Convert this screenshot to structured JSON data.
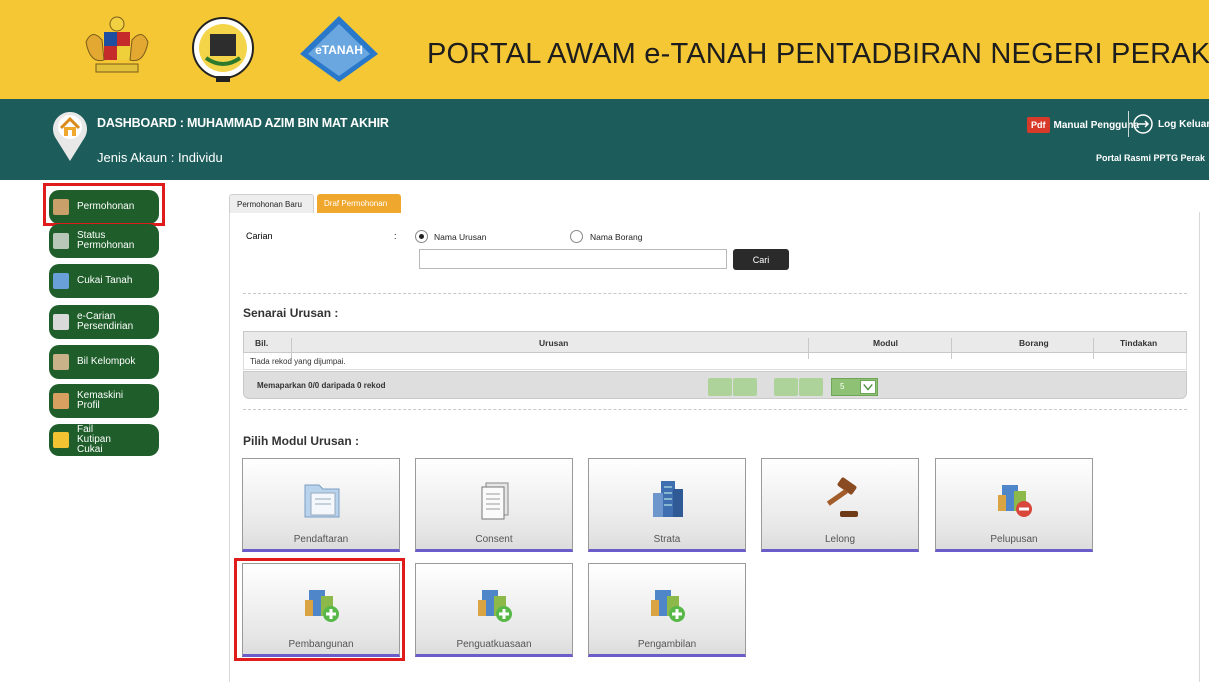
{
  "banner": {
    "title": "PORTAL AWAM e-TANAH PENTADBIRAN NEGERI PERAK",
    "logo3_text": "eTANAH"
  },
  "header": {
    "dashboard_title": "DASHBOARD : MUHAMMAD AZIM BIN MAT AKHIR",
    "account_type": "Jenis Akaun : Individu",
    "pdf_badge": "Pdf",
    "manual_label": "Manual Pengguna",
    "logout_label": "Log Keluar",
    "portal_label": "Portal Rasmi PPTG Perak"
  },
  "sidebar": {
    "items": [
      {
        "label": "Permohonan",
        "icon": "document-icon",
        "selected": true
      },
      {
        "label": "Status Permohonan",
        "icon": "status-icon"
      },
      {
        "label": "Cukai Tanah",
        "icon": "tax-icon"
      },
      {
        "label": "e-Carian Persendirian",
        "icon": "search-doc-icon"
      },
      {
        "label": "Bil Kelompok",
        "icon": "bill-icon"
      },
      {
        "label": "Kemaskini Profil",
        "icon": "user-icon"
      },
      {
        "label": "Fail Kutipan Cukai",
        "icon": "folder-icon"
      }
    ]
  },
  "tabs": [
    {
      "label": "Permohonan Baru",
      "active": false
    },
    {
      "label": "Draf Permohonan",
      "active": true
    }
  ],
  "search": {
    "label": "Carian",
    "colon": ":",
    "option_1": "Nama Urusan",
    "option_2": "Nama Borang",
    "value": "",
    "button": "Cari"
  },
  "list": {
    "title": "Senarai Urusan :",
    "columns": [
      "Bil.",
      "Urusan",
      "Modul",
      "Borang",
      "Tindakan"
    ],
    "empty_message": "Tiada rekod yang dijumpai.",
    "footer": "Memaparkan 0/0 daripada 0 rekod",
    "page_size": "5"
  },
  "modules": {
    "title": "Pilih Modul Urusan :",
    "items": [
      {
        "label": "Pendaftaran",
        "icon": "folder-icon"
      },
      {
        "label": "Consent",
        "icon": "document-stack-icon"
      },
      {
        "label": "Strata",
        "icon": "building-icon"
      },
      {
        "label": "Lelong",
        "icon": "gavel-icon"
      },
      {
        "label": "Pelupusan",
        "icon": "building-remove-icon"
      },
      {
        "label": "Pembangunan",
        "icon": "building-add-icon",
        "selected": true
      },
      {
        "label": "Penguatkuasaan",
        "icon": "building-add-icon"
      },
      {
        "label": "Pengambilan",
        "icon": "building-add-icon"
      }
    ]
  },
  "colors": {
    "banner": "#f6c735",
    "header": "#1c5d5c",
    "sidebar_button": "#1f5e2a",
    "active_tab": "#f0a72d",
    "highlight": "#e01b1b",
    "tile_underline": "#6a5cc9"
  }
}
